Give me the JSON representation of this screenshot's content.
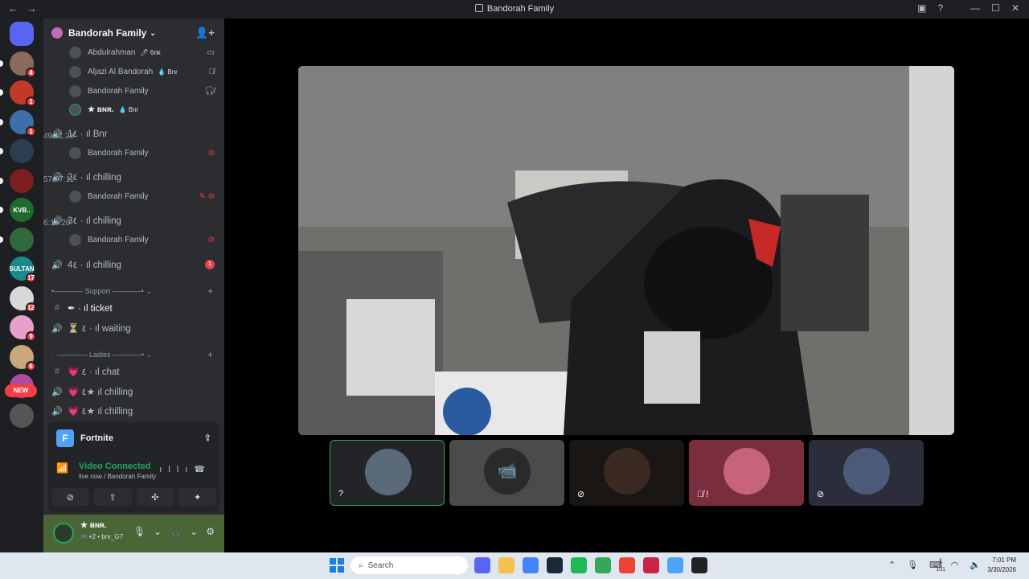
{
  "window": {
    "title": "Bandorah Family",
    "back": "←",
    "forward": "→",
    "controls": {
      "inbox": "▣",
      "help": "?",
      "minimize": "—",
      "maximize": "☐",
      "close": "✕"
    }
  },
  "rail": {
    "guilds": [
      {
        "name": "discord-home",
        "label": "",
        "color": "#5865f2",
        "badge": ""
      },
      {
        "name": "guild-1",
        "label": "",
        "color": "#8a6a5a",
        "badge": "4"
      },
      {
        "name": "guild-2",
        "label": "",
        "color": "#c0392b",
        "badge": "1"
      },
      {
        "name": "guild-3",
        "label": "",
        "color": "#3d6fa8",
        "badge": "1"
      },
      {
        "name": "guild-4",
        "label": "",
        "color": "#2c3e50",
        "badge": ""
      },
      {
        "name": "guild-5",
        "label": "",
        "color": "#7b1f1f",
        "badge": ""
      },
      {
        "name": "guild-6",
        "label": "KVB..",
        "color": "#1e6b2a",
        "badge": ""
      },
      {
        "name": "guild-7",
        "label": "",
        "color": "#2f6b3a",
        "badge": ""
      },
      {
        "name": "guild-8",
        "label": "SULTAN",
        "color": "#1b8a8a",
        "badge": "17"
      },
      {
        "name": "guild-9",
        "label": "",
        "color": "#d8d8d8",
        "badge": "12"
      },
      {
        "name": "guild-10",
        "label": "",
        "color": "#e8a0c8",
        "badge": "9"
      },
      {
        "name": "guild-11",
        "label": "",
        "color": "#c8a878",
        "badge": "6"
      },
      {
        "name": "guild-12",
        "label": "",
        "color": "#b04aa0",
        "badge": ""
      },
      {
        "name": "guild-13",
        "label": "",
        "color": "#555555",
        "badge": ""
      }
    ],
    "new_label": "NEW"
  },
  "sidebar": {
    "server_name": "Bandorah Family",
    "voice_users_top": [
      {
        "name": "Abdulrahman",
        "tag": "🖊 6nk",
        "icon": "▭"
      },
      {
        "name": "Aljazi Al Bandorah",
        "tag": "💧 Bnr",
        "icon": "🎙̸"
      },
      {
        "name": "Bandorah Family",
        "tag": "",
        "icon": "🎧̸"
      },
      {
        "name": "★ ʙɴʀ.",
        "tag": "💧 Bnr",
        "icon": ""
      }
    ],
    "channels": [
      {
        "name": "1٤ · ıl Bnr",
        "timer": "49:11:28",
        "user": "Bandorah Family",
        "user_icon": "⊘"
      },
      {
        "name": "2٤ · ıl chilling",
        "timer": "57:07:11",
        "user": "Bandorah Family",
        "user_icon": "✎ ⊘"
      },
      {
        "name": "3٤ · ıl chilling",
        "timer": "6:18:20",
        "user": "Bandorah Family",
        "user_icon": "⊘"
      },
      {
        "name": "4٤ · ıl chilling",
        "badge": "1"
      }
    ],
    "category_support": "•———— Support ————• ⌄",
    "support_channels": [
      {
        "icon": "#",
        "name": "✒ · ıl ticket"
      },
      {
        "icon": "🔊",
        "name": "⏳ ٤ · ıl waiting"
      }
    ],
    "category_ladies": "· ·———— Ladies ————• ⌄",
    "ladies_channels": [
      {
        "icon": "#",
        "name": "💗 ٤ · ıl chat"
      },
      {
        "icon": "🔊",
        "name": "💗 ٤★ ıl chilling"
      },
      {
        "icon": "🔊",
        "name": "💗 ٤★ ıl chilling"
      }
    ]
  },
  "activity": {
    "game": "Fortnite",
    "game_icon_letter": "F"
  },
  "voice_panel": {
    "status": "Video Connected",
    "sub": "live now / Bandorah Family",
    "buttons": [
      "⊘",
      "⇪",
      "✣",
      "✦"
    ]
  },
  "user": {
    "name": "★ ʙɴʀ.",
    "status": "🎮+2 • bnr_G7",
    "controls": [
      "🎙",
      "⌄",
      "🎧",
      "⌄",
      "⚙"
    ]
  },
  "stage": {
    "tiles": [
      {
        "name": "tile-self",
        "bg": "#232428",
        "border": "#23a55a",
        "avatar": "#5a6a7a",
        "mini": "?"
      },
      {
        "name": "tile-camera-off",
        "bg": "#4b4b4b",
        "border": "",
        "avatar": "#2a2a2a",
        "mini": ""
      },
      {
        "name": "tile-user-suit",
        "bg": "#1a1614",
        "border": "",
        "avatar": "#3a2a22",
        "mini": "⊘"
      },
      {
        "name": "tile-user-red",
        "bg": "#7a2d3e",
        "border": "",
        "avatar": "#c8647a",
        "mini": "🎙̸ !"
      },
      {
        "name": "tile-user-blue",
        "bg": "#2b2d3a",
        "border": "",
        "avatar": "#4a5a78",
        "mini": "⊘"
      }
    ]
  },
  "taskbar": {
    "search_placeholder": "Search",
    "apps": [
      "#5865f2",
      "#f2c14e",
      "#4285f4",
      "#1b2838",
      "#1db954",
      "#34a853",
      "#ea4335",
      "#cc2244",
      "#4fa3f7",
      "#222222"
    ],
    "lang_top": "ع",
    "lang_bottom": "101",
    "time": "7:01 PM",
    "date": "3/30/2026"
  }
}
